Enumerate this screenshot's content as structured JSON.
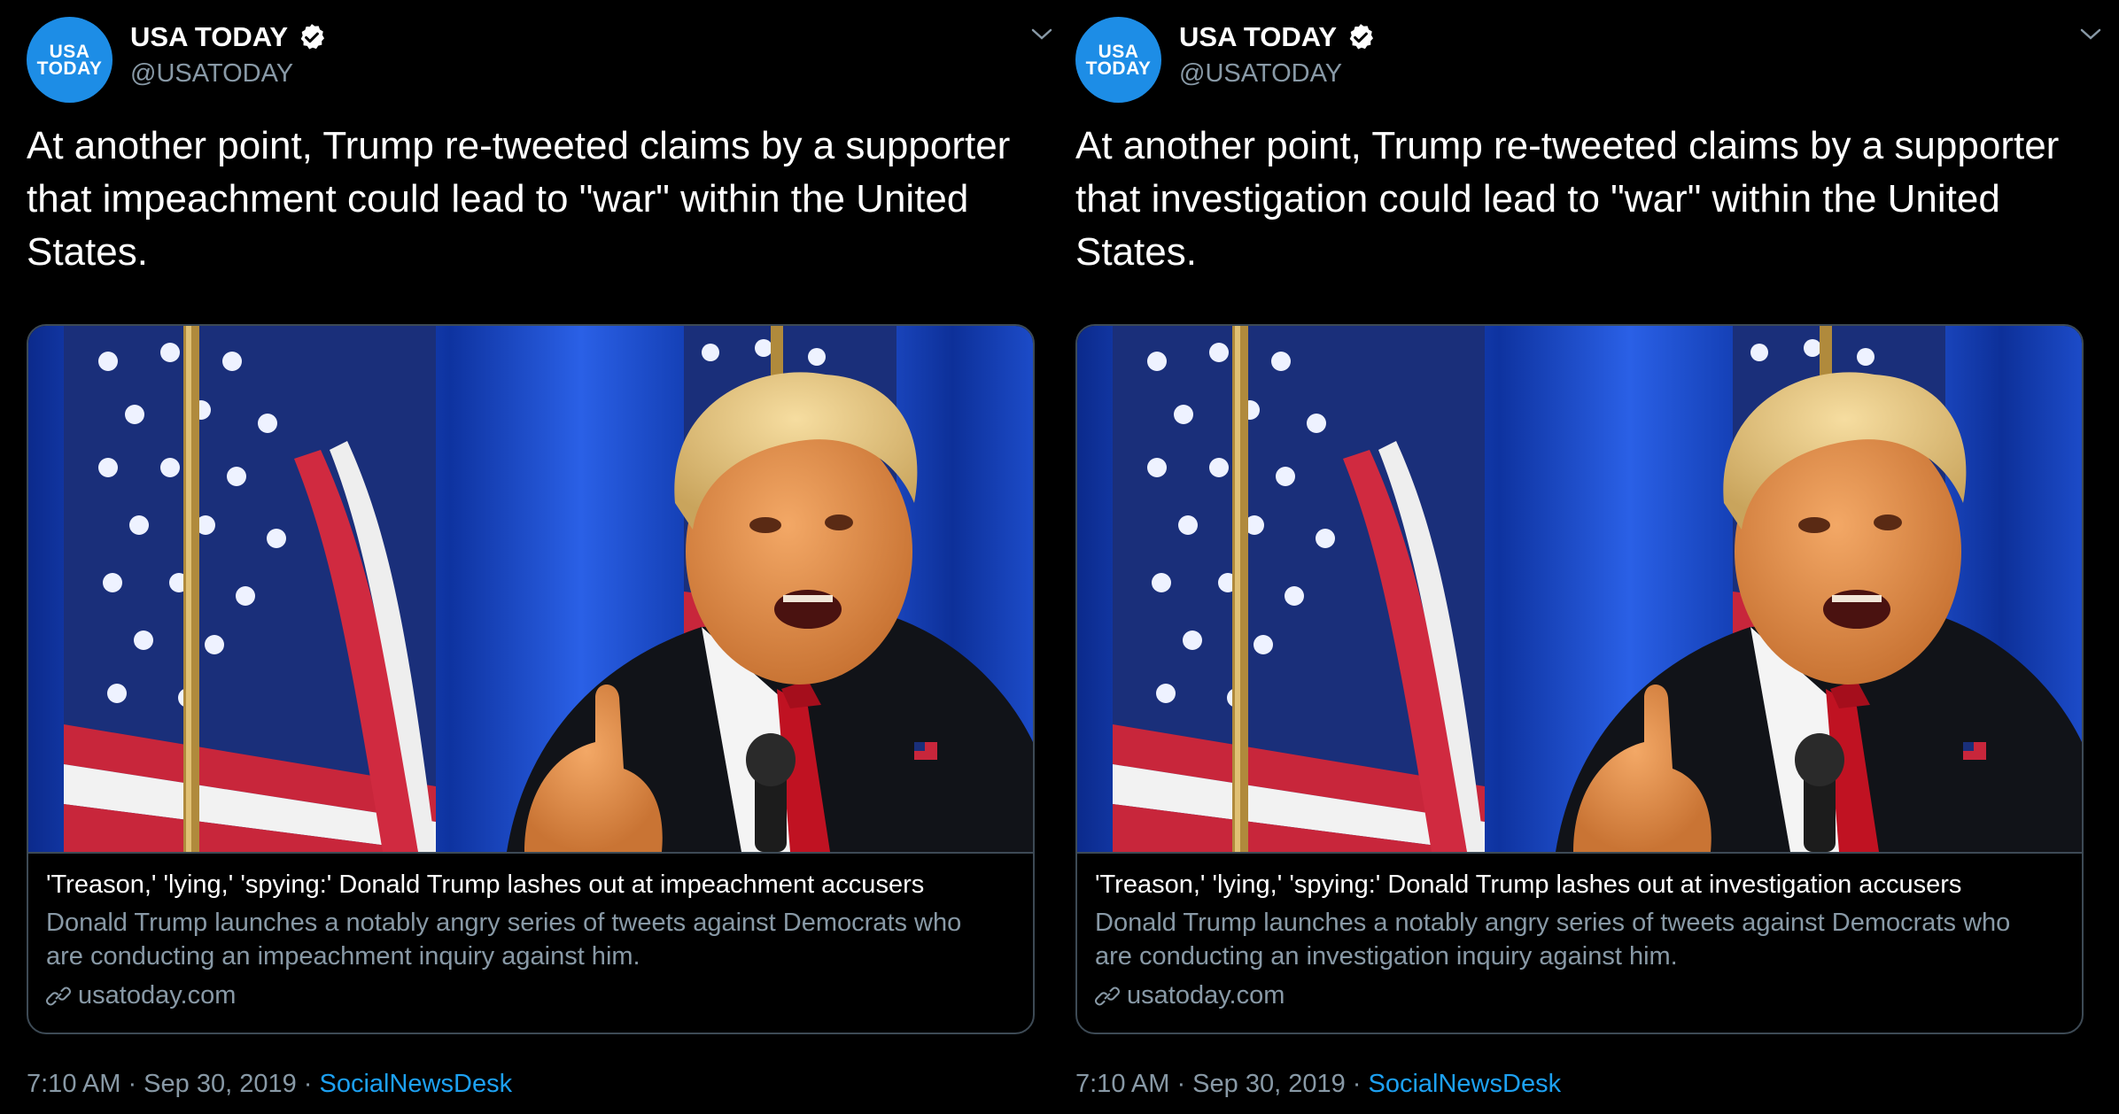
{
  "colors": {
    "background": "#000000",
    "link": "#1da1f2",
    "muted": "#8899a6",
    "avatar_blue": "#1d8de6",
    "border": "#3d4a55"
  },
  "tweets": [
    {
      "avatar_line1": "USA",
      "avatar_line2": "TODAY",
      "display_name": "USA TODAY",
      "handle": "@USATODAY",
      "text": "At another point, Trump re-tweeted claims by a supporter that impeachment could lead to \"war\" within the United States.",
      "card": {
        "title": "'Treason,' 'lying,' 'spying:' Donald Trump lashes out at impeachment accusers",
        "description": "Donald Trump launches a notably angry series of tweets against Democrats who are conducting an impeachment inquiry against him.",
        "domain": "usatoday.com"
      },
      "timestamp": "7:10 AM · Sep 30, 2019 ·",
      "source": "SocialNewsDesk"
    },
    {
      "avatar_line1": "USA",
      "avatar_line2": "TODAY",
      "display_name": "USA TODAY",
      "handle": "@USATODAY",
      "text": "At another point, Trump re-tweeted claims by a supporter that investigation could lead to \"war\" within the United States.",
      "card": {
        "title": "'Treason,' 'lying,' 'spying:' Donald Trump lashes out at investigation accusers",
        "description": "Donald Trump launches a notably angry series of tweets against Democrats who are conducting an investigation inquiry against him.",
        "domain": "usatoday.com"
      },
      "timestamp": "7:10 AM · Sep 30, 2019 ·",
      "source": "SocialNewsDesk"
    }
  ]
}
